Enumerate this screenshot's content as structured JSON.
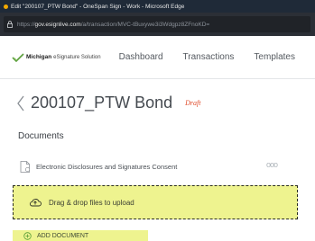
{
  "browser": {
    "window_title": "Edit \"200107_PTW Bond\" - OneSpan Sign - Work - Microsoft Edge",
    "url_prefix": "https://",
    "url_host": "gov.esignlive.com",
    "url_path": "/a/transaction/MVC-tBuxywe3i3Wdgpz8ZFnoKD="
  },
  "navbar": {
    "brand_name": "Michigan",
    "brand_sub": "eSignature Solution",
    "links": [
      "Dashboard",
      "Transactions",
      "Templates"
    ]
  },
  "package": {
    "back_icon": "chevron-left-icon",
    "title": "200107_PTW Bond",
    "status": "Draft"
  },
  "documents": {
    "section_title": "Documents",
    "items": [
      {
        "name": "Electronic Disclosures and Signatures Consent",
        "icon": "document-icon",
        "more": "ooo"
      }
    ]
  },
  "dropzone": {
    "icon": "cloud-upload-icon",
    "label": "Drag & drop files to upload"
  },
  "add_document": {
    "icon": "plus-circle-icon",
    "label": "ADD DOCUMENT"
  },
  "colors": {
    "highlight": "#eef38f",
    "status_draft": "#e04e2e",
    "brand_green": "#5a9e3a",
    "titlebar": "#1f2a38"
  }
}
